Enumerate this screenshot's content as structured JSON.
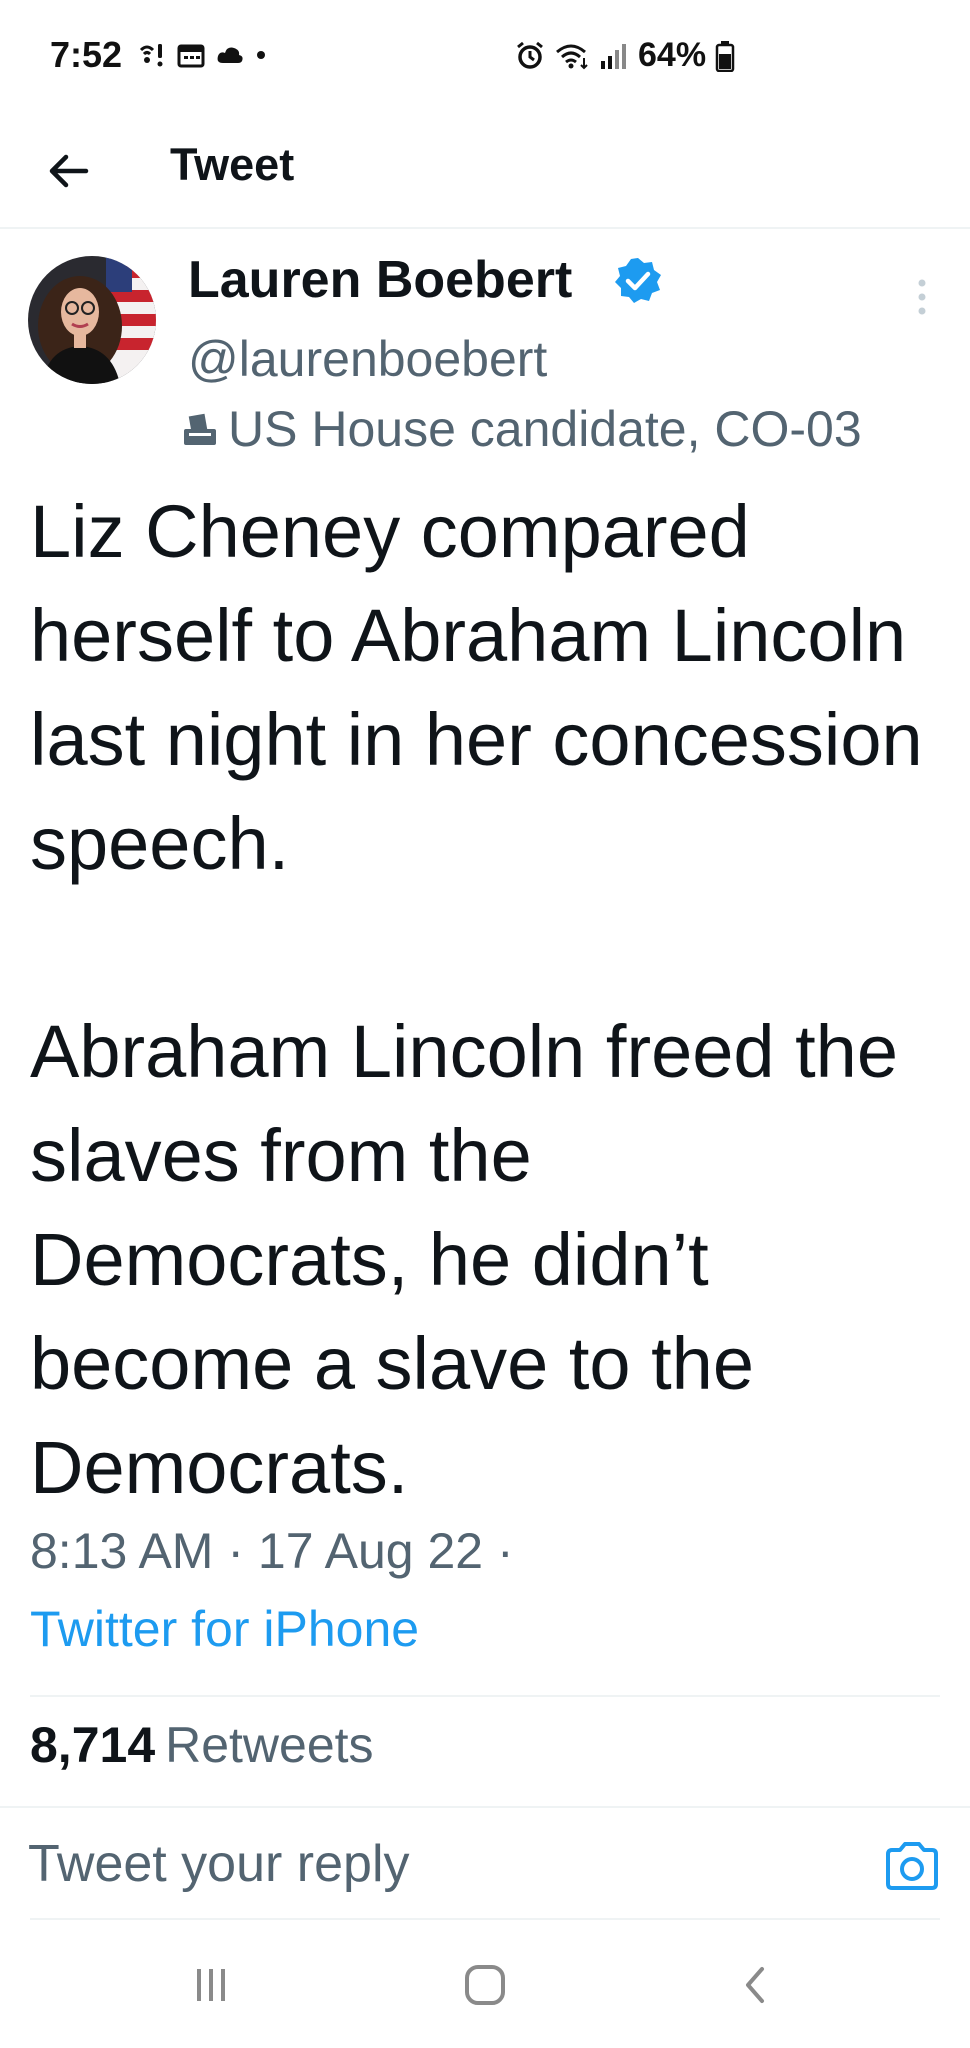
{
  "status_bar": {
    "time": "7:52",
    "battery": "64%",
    "icons_left": [
      "wifi-calling-icon",
      "calendar-icon",
      "cloud-icon",
      "dot-icon"
    ],
    "icons_right": [
      "alarm-icon",
      "wifi-icon",
      "signal-icon",
      "battery-icon"
    ]
  },
  "header": {
    "title": "Tweet",
    "back_icon": "arrow-left-icon"
  },
  "tweet": {
    "author_name": "Lauren Boebert",
    "verified": true,
    "handle": "@laurenboebert",
    "label": "US House candidate, CO-03",
    "label_icon": "ballot-box-icon",
    "text": "Liz Cheney compared herself to Abraham Lincoln last night in her concession speech.\n\nAbraham Lincoln freed the slaves from the Democrats, he didn’t become a slave to the Democrats.",
    "time": "8:13 AM · 17 Aug 22 ·",
    "source": "Twitter for iPhone",
    "retweet_count": "8,714",
    "retweet_label": "Retweets"
  },
  "reply": {
    "placeholder": "Tweet your reply",
    "camera_icon": "camera-icon"
  },
  "nav": {
    "recents_icon": "recents-icon",
    "home_icon": "home-icon",
    "back_icon": "back-chevron-icon"
  },
  "colors": {
    "text": "#0f1419",
    "secondary": "#536471",
    "accent": "#1d9bf0",
    "divider": "#eff3f4"
  }
}
